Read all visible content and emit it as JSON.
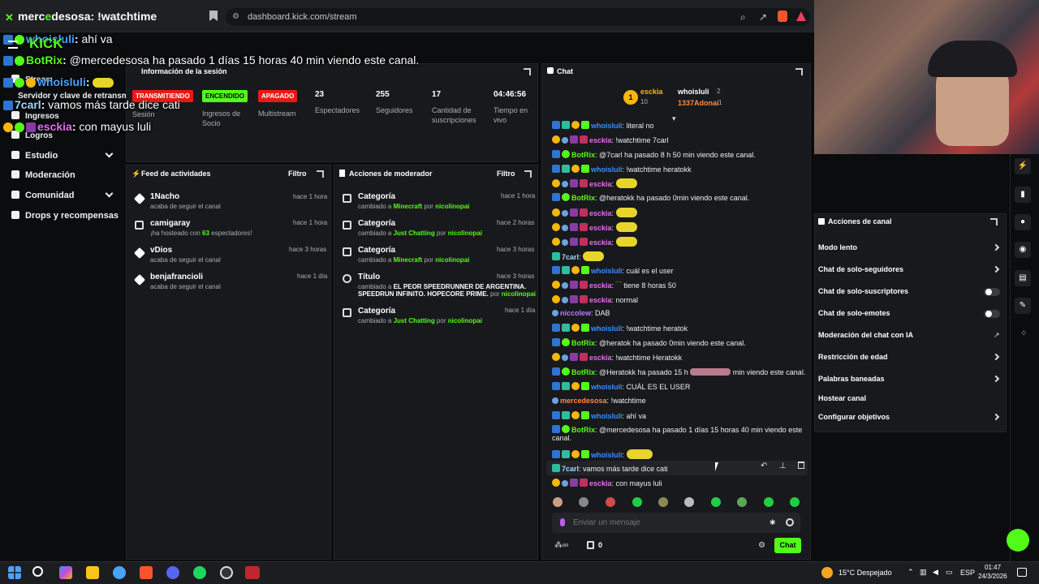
{
  "browser": {
    "tab_title_prefix": "merc",
    "tab_title_mid": "e",
    "tab_title_suffix": "desosa: !watchtime",
    "url": "dashboard.kick.com/stream"
  },
  "overlay": {
    "logo": "KICK",
    "lines": [
      {
        "user": "whoisluli",
        "text": "ahí va"
      },
      {
        "user": "BotRix",
        "text": "@mercedesosa ha pasado 1 días 15 horas 40 min viendo este canal."
      },
      {
        "user": "whoisluli",
        "text": ""
      },
      {
        "user": "7carl",
        "text": "vamos más tarde dice cati"
      },
      {
        "user": "esckia",
        "text": "con mayus luli"
      }
    ]
  },
  "sidebar": {
    "items": [
      {
        "label": "Stream"
      },
      {
        "label": "Servidor y clave de retransm"
      },
      {
        "label": "Ingresos"
      },
      {
        "label": "Logros"
      },
      {
        "label": "Estudio"
      },
      {
        "label": "Moderación"
      },
      {
        "label": "Comunidad"
      },
      {
        "label": "Drops y recompensas"
      }
    ]
  },
  "session": {
    "title": "Información de la sesión",
    "transmitting": "TRANSMITIENDO",
    "session_label": "Sesión",
    "partner_pill": "ENCENDIDO",
    "partner_label_1": "Ingresos de",
    "partner_label_2": "Socio",
    "multistream_pill": "APAGADO",
    "multistream_label": "Multistream",
    "viewers_value": "23",
    "viewers_label": "Espectadores",
    "followers_value": "255",
    "followers_label": "Seguidores",
    "subs_value": "17",
    "subs_label_1": "Cantidad de",
    "subs_label_2": "suscripciones",
    "live_value": "04:46:56",
    "live_label_1": "Tiempo en",
    "live_label_2": "vivo"
  },
  "activity": {
    "title": "Feed de actividades",
    "filter": "Filtro",
    "items": [
      {
        "name": "1Nacho",
        "sub": "acaba de seguir el canal",
        "time": "hace 1 hora"
      },
      {
        "name": "camigaray",
        "sub_pre": "¡ha hosteado con ",
        "sub_num": "63",
        "sub_post": " espectadores!",
        "time": "hace 1 hora"
      },
      {
        "name": "vDios",
        "sub": "acaba de seguir el canal",
        "time": "hace 3 horas"
      },
      {
        "name": "benjafrancioli",
        "sub": "acaba de seguir el canal",
        "time": "hace 1 día"
      }
    ]
  },
  "modactions": {
    "title": "Acciones de moderador",
    "filter": "Filtro",
    "items": [
      {
        "name": "Categoría",
        "pre": "cambiado a ",
        "val": "Minecraft",
        "mid": " por ",
        "by": "nicolinopai",
        "time": "hace 1 hora"
      },
      {
        "name": "Categoría",
        "pre": "cambiado a ",
        "val": "Just Chatting",
        "mid": " por ",
        "by": "nicolinopai",
        "time": "hace 2 horas"
      },
      {
        "name": "Categoría",
        "pre": "cambiado a ",
        "val": "Minecraft",
        "mid": " por ",
        "by": "nicolinopai",
        "time": "hace 3 horas"
      },
      {
        "name": "Título",
        "pre": "cambiado a ",
        "val": "EL PEOR SPEEDRUNNER DE ARGENTINA.",
        "val2": "SPEEDRUN INFINITO. HOPECORE PRIME.",
        "mid": " por ",
        "by": "nicolinopai",
        "time": "hace 3 horas"
      },
      {
        "name": "Categoría",
        "pre": "cambiado a ",
        "val": "Just Chatting",
        "mid": " por ",
        "by": "nicolinopai",
        "time": "hace 1 día"
      }
    ]
  },
  "chat": {
    "title": "Chat",
    "top1_name": "esckia",
    "top1_count": "10",
    "top2_name": "whoisluli",
    "top2_count": "2",
    "top3_name": "1337Adonai",
    "top3_count": "1",
    "rank": "1",
    "messages": [
      {
        "user": "whoisluli",
        "text": "literal no"
      },
      {
        "user": "esckia",
        "text": "!watchtime 7carl"
      },
      {
        "user": "BotRix",
        "text": "@7carl ha pasado 8 h 50 min viendo este canal."
      },
      {
        "user": "whoisluli",
        "text": "!watchtime heratokk"
      },
      {
        "user": "esckia",
        "text": ""
      },
      {
        "user": "BotRix",
        "text": "@heratokk ha pasado 0min viendo este canal."
      },
      {
        "user": "esckia",
        "text": ""
      },
      {
        "user": "esckia",
        "text": ""
      },
      {
        "user": "esckia",
        "text": ""
      },
      {
        "user": "7carl",
        "text": ""
      },
      {
        "user": "whoisluli",
        "text": "cuál es el user"
      },
      {
        "user": "esckia",
        "text": "tiene 8 horas 50"
      },
      {
        "user": "esckia",
        "text": "normal"
      },
      {
        "user": "niccolew",
        "text": "DAB"
      },
      {
        "user": "whoisluli",
        "text": "!watchtime heratok"
      },
      {
        "user": "BotRix",
        "text": "@heratok ha pasado 0min viendo este canal."
      },
      {
        "user": "esckia",
        "text": "!watchtime Heratokk"
      },
      {
        "user": "BotRix",
        "text": "@Heratokk ha pasado 15 h",
        "text2": "min viendo este canal."
      },
      {
        "user": "whoisluli",
        "text": "CUÁL ES EL USER"
      },
      {
        "user": "mercedesosa",
        "text": "!watchtime"
      },
      {
        "user": "whoisluli",
        "text": "ahí va"
      },
      {
        "user": "BotRix",
        "text": "@mercedesosa ha pasado 1 días 15 horas 40 min viendo este",
        "text2": "canal."
      },
      {
        "user": "whoisluli",
        "text": ""
      },
      {
        "user": "7carl",
        "text": "vamos más tarde dice cati"
      },
      {
        "user": "esckia",
        "text": "con mayus luli"
      }
    ],
    "placeholder": "Enviar un mensaje",
    "points": "0",
    "send_label": "Chat"
  },
  "channel_actions": {
    "title": "Acciones de canal",
    "items": [
      {
        "label": "Modo lento"
      },
      {
        "label": "Chat de solo-seguidores"
      },
      {
        "label": "Chat de solo-suscriptores"
      },
      {
        "label": "Chat de solo-emotes"
      },
      {
        "label": "Moderación del chat con IA"
      },
      {
        "label": "Restricción de edad"
      },
      {
        "label": "Palabras baneadas"
      },
      {
        "label": "Hostear canal"
      },
      {
        "label": "Configurar objetivos"
      }
    ]
  },
  "taskbar": {
    "weather": "15°C  Despejado",
    "lang": "ESP",
    "time": "01:47",
    "date": "24/3/2026"
  },
  "colors": {
    "accent": "#53fc18",
    "live": "#e91916"
  }
}
